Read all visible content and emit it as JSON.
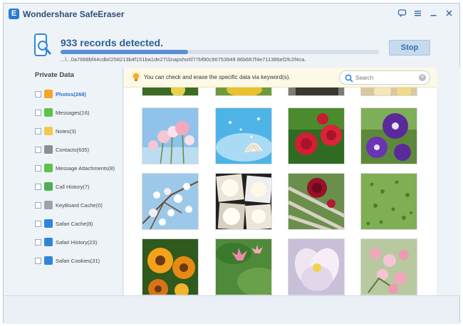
{
  "app": {
    "title": "Wondershare SafeEraser",
    "logo_letter": "E"
  },
  "window_controls": [
    "feedback-icon",
    "menu-icon",
    "minimize-icon",
    "close-icon"
  ],
  "scan": {
    "records_text": "933 records detected.",
    "progress_fraction": 0.4,
    "path_text": "...\\...0a7688bf44cdb0258213b4f151ba1de27\\Snapshot\\f77bf90c96753949 86b667f4e711386ef2fc2f4ca.",
    "stop_label": "Stop"
  },
  "sidebar": {
    "title": "Private Data",
    "items": [
      {
        "label": "Photos(268)",
        "icon": "photos-icon",
        "color": "#f4a623",
        "active": true
      },
      {
        "label": "Messages(16)",
        "icon": "messages-icon",
        "color": "#5cc24a",
        "active": false
      },
      {
        "label": "Notes(3)",
        "icon": "notes-icon",
        "color": "#f2c94c",
        "active": false
      },
      {
        "label": "Contacts(635)",
        "icon": "contacts-icon",
        "color": "#8a8f96",
        "active": false
      },
      {
        "label": "Message Attachments(8)",
        "icon": "attachments-icon",
        "color": "#5cc24a",
        "active": false
      },
      {
        "label": "Call History(7)",
        "icon": "call-history-icon",
        "color": "#4caf50",
        "active": false
      },
      {
        "label": "KeyBoard Cache(0)",
        "icon": "keyboard-cache-icon",
        "color": "#9aa3ad",
        "active": false
      },
      {
        "label": "Safari Cache(8)",
        "icon": "safari-icon",
        "color": "#2f86d8",
        "active": false
      },
      {
        "label": "Safari History(23)",
        "icon": "safari-icon",
        "color": "#2f86d8",
        "active": false
      },
      {
        "label": "Safari Cookies(31)",
        "icon": "safari-icon",
        "color": "#2f86d8",
        "active": false
      }
    ]
  },
  "keyword": {
    "hint": "You can check and erase the specific data via keyword(s).",
    "search_placeholder": "Search"
  },
  "colors": {
    "accent": "#2e73c6",
    "highlight_bar": "#fcf9e6",
    "background": "#eef3f8"
  }
}
